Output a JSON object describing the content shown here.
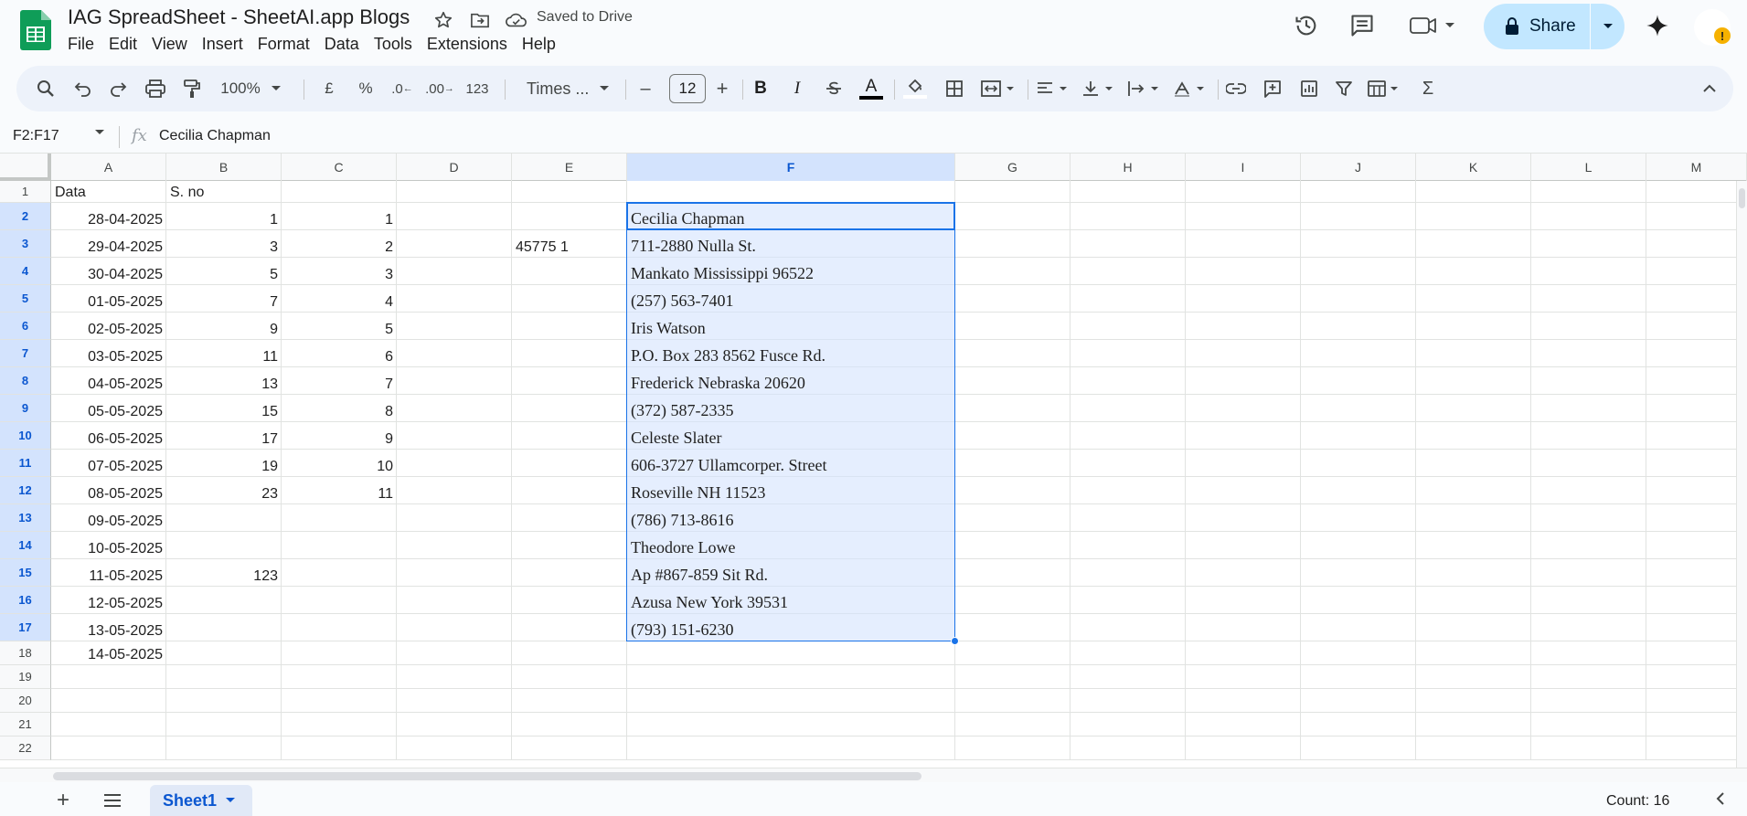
{
  "app": {
    "doc_title": "IAG SpreadSheet - SheetAI.app Blogs",
    "saved_status": "Saved to Drive",
    "menu": [
      "File",
      "Edit",
      "View",
      "Insert",
      "Format",
      "Data",
      "Tools",
      "Extensions",
      "Help"
    ],
    "share_label": "Share"
  },
  "toolbar": {
    "zoom": "100%",
    "currency": "£",
    "percent": "%",
    "dec_decrease": ".0",
    "dec_increase": ".00",
    "number_format": "123",
    "font_name": "Times ...",
    "font_size": "12",
    "bold": "B",
    "italic": "I",
    "text_color": "A",
    "minus": "–",
    "plus": "+"
  },
  "formula_bar": {
    "name_box": "F2:F17",
    "fx": "fx",
    "content": "Cecilia Chapman"
  },
  "grid": {
    "columns": [
      "A",
      "B",
      "C",
      "D",
      "E",
      "F",
      "G",
      "H",
      "I",
      "J",
      "K",
      "L",
      "M"
    ],
    "rows": [
      "1",
      "2",
      "3",
      "4",
      "5",
      "6",
      "7",
      "8",
      "9",
      "10",
      "11",
      "12",
      "13",
      "14",
      "15",
      "16",
      "17",
      "18",
      "19",
      "20",
      "21",
      "22"
    ],
    "selected_column": "F",
    "selected_range": "F2:F17",
    "colA": [
      "Data",
      "28-04-2025",
      "29-04-2025",
      "30-04-2025",
      "01-05-2025",
      "02-05-2025",
      "03-05-2025",
      "04-05-2025",
      "05-05-2025",
      "06-05-2025",
      "07-05-2025",
      "08-05-2025",
      "09-05-2025",
      "10-05-2025",
      "11-05-2025",
      "12-05-2025",
      "13-05-2025",
      "14-05-2025"
    ],
    "colB": [
      "S. no",
      "1",
      "3",
      "5",
      "7",
      "9",
      "11",
      "13",
      "15",
      "17",
      "19",
      "23",
      "",
      "",
      "123",
      "",
      "",
      ""
    ],
    "colC": [
      "",
      "1",
      "2",
      "3",
      "4",
      "5",
      "6",
      "7",
      "8",
      "9",
      "10",
      "11",
      "",
      "",
      "",
      "",
      "",
      ""
    ],
    "cellE3": "45775 1",
    "colF": [
      "",
      "Cecilia Chapman",
      "711-2880 Nulla St.",
      "Mankato Mississippi 96522",
      "(257) 563-7401",
      "Iris Watson",
      "P.O. Box 283 8562 Fusce Rd.",
      "Frederick Nebraska 20620",
      "(372) 587-2335",
      "Celeste Slater",
      "606-3727 Ullamcorper. Street",
      "Roseville NH 11523",
      "(786) 713-8616",
      "Theodore Lowe",
      "Ap #867-859 Sit Rd.",
      "Azusa New York 39531",
      "(793) 151-6230",
      ""
    ]
  },
  "bottom": {
    "sheet_tab": "Sheet1",
    "add_sheet": "+",
    "count": "Count: 16"
  },
  "colors": {
    "accent": "#1a73e8",
    "share_bg": "#c2e7ff",
    "selection": "#d3e3fd",
    "sheets_green": "#0f9d58"
  },
  "icons": [
    "sheets-logo-icon",
    "star-icon",
    "move-to-folder-icon",
    "cloud-saved-icon",
    "history-icon",
    "comment-icon",
    "meet-icon",
    "lock-icon",
    "gemini-spark-icon",
    "search-icon",
    "undo-icon",
    "redo-icon",
    "print-icon",
    "paint-format-icon",
    "fill-color-icon",
    "borders-icon",
    "merge-icon",
    "align-icon",
    "valign-icon",
    "wrap-icon",
    "rotate-icon",
    "link-icon",
    "add-comment-icon",
    "chart-icon",
    "filter-icon",
    "table-icon",
    "sigma-icon",
    "collapse-icon",
    "all-sheets-icon"
  ]
}
